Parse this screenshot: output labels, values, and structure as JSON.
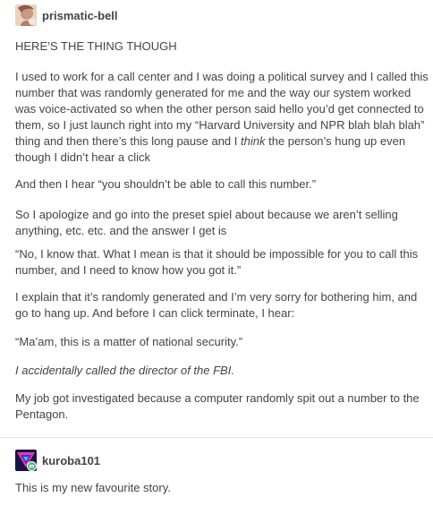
{
  "posts": [
    {
      "username": "prismatic-bell",
      "paragraphs": {
        "p0": "HERE’S THE THING THOUGH",
        "p1a": "I used to work for a call center and I was doing a political survey and I called this number that was randomly generated for me and the way our system worked was voice-activated so when the other person said hello you’d get connected to them, so I just launch right into my “Harvard University and NPR blah blah blah” thing and then there’s this long pause and I ",
        "p1b": "think",
        "p1c": " the person’s hung up even though I didn’t hear a click",
        "p2": "And then I hear “you shouldn’t be able to call this number.”",
        "p3": "So I apologize and go into the preset spiel about because we aren’t selling anything, etc. etc. and the answer I get is",
        "p4": "“No, I know that. What I mean is that it should be impossible for you to call this number, and I need to know how you got it.”",
        "p5": "I explain that it’s randomly generated and I’m very sorry for bothering him, and go to hang up. And before I can click terminate, I hear:",
        "p6": "“Ma’am, this is a matter of national security.”",
        "p7": "I accidentally called the director of the FBI.",
        "p8": "My job got investigated because a computer randomly spit out a number to the Pentagon."
      }
    },
    {
      "username": "kuroba101",
      "paragraphs": {
        "p0": "This is my new favourite story."
      }
    }
  ],
  "icons": {
    "avatar1": "avatar-image",
    "avatar2": "avatar-image",
    "reblog_badge": "reblog-icon"
  },
  "colors": {
    "text": "#444444",
    "divider": "#e6e6e6",
    "reblog_badge": "#56bc8a"
  }
}
